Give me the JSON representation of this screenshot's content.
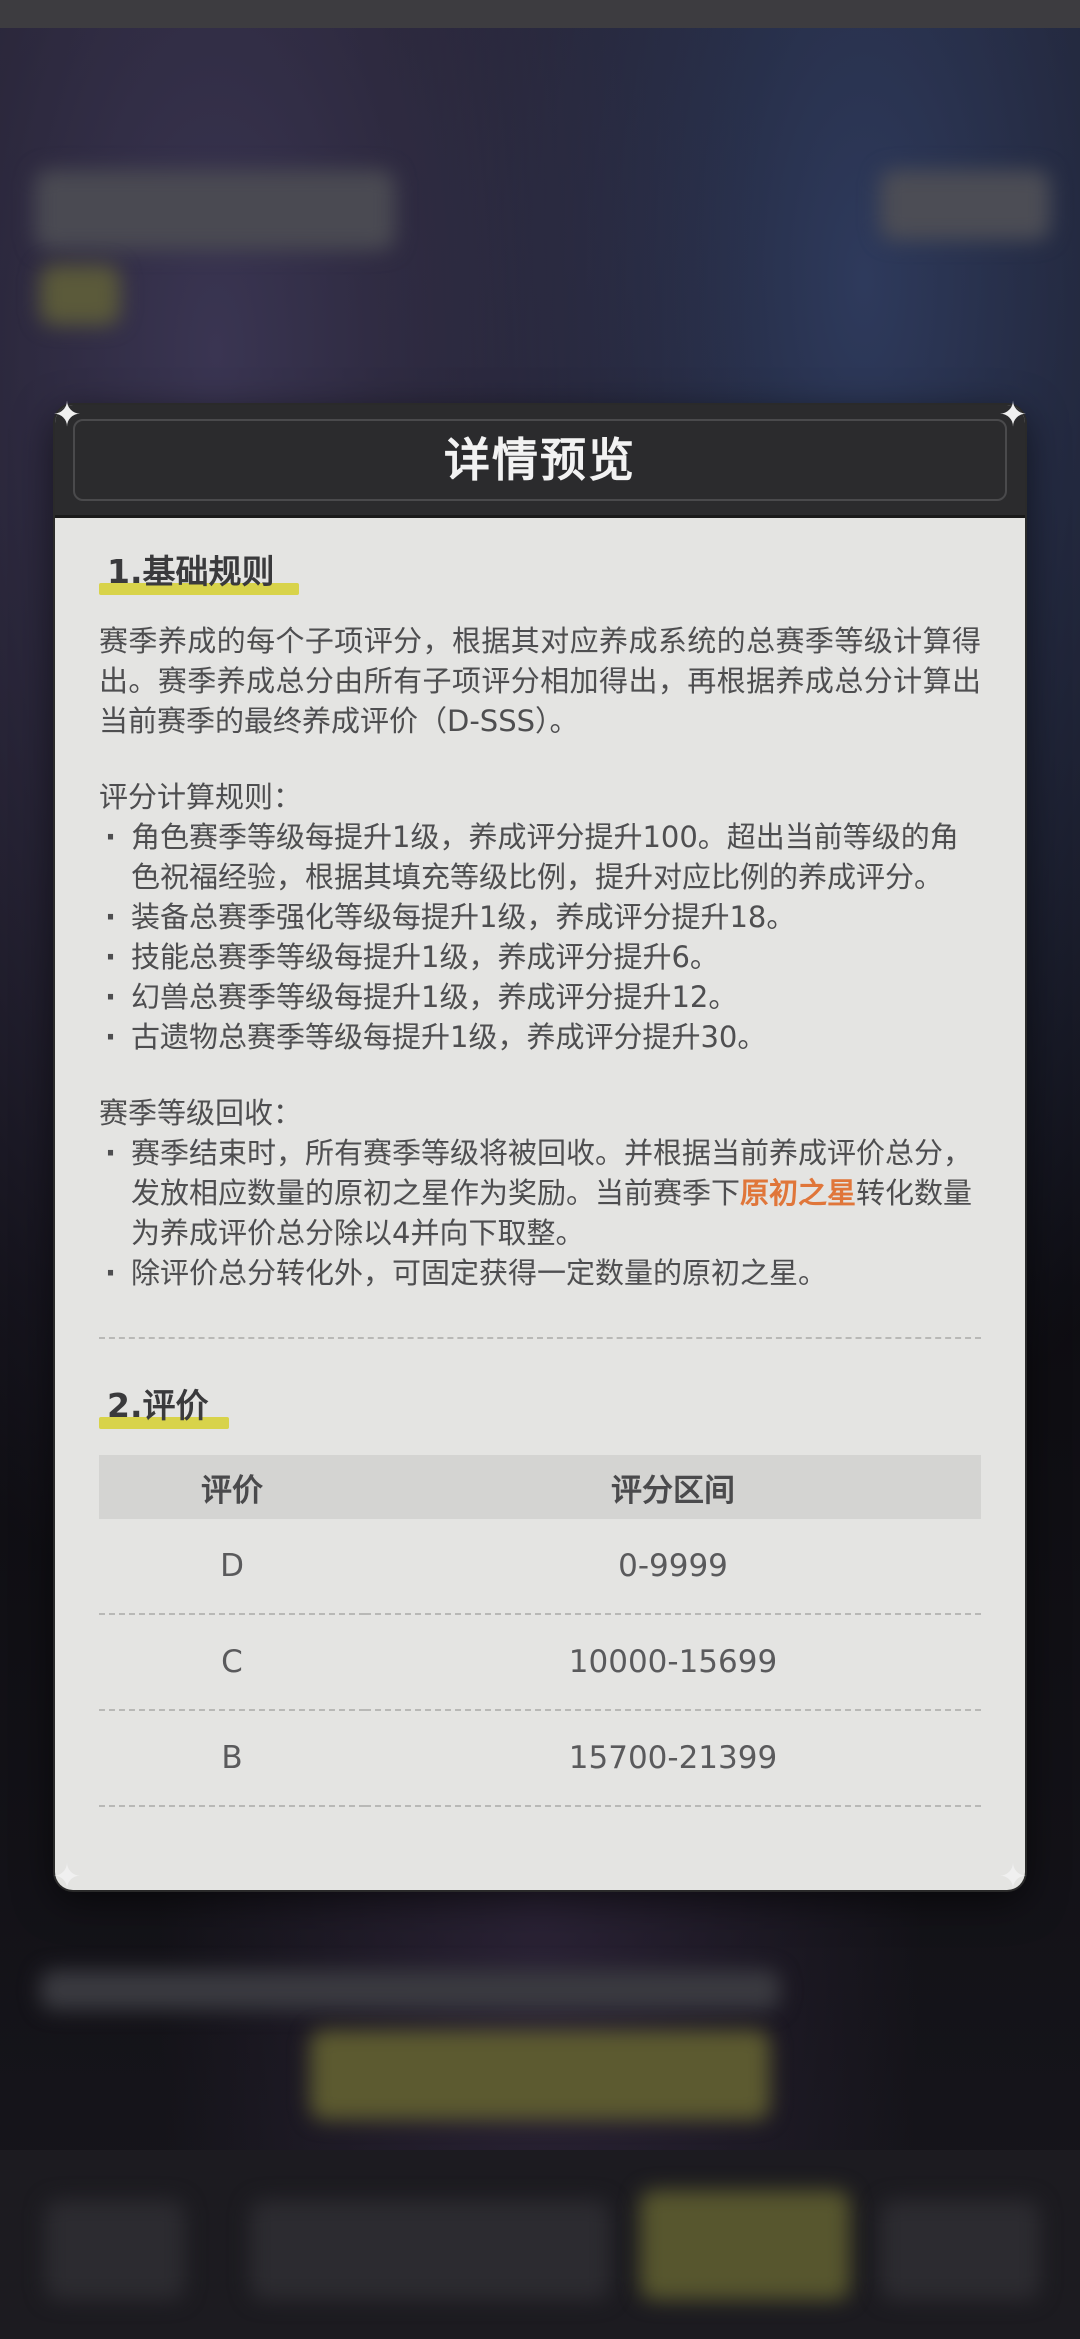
{
  "dialog": {
    "title": "详情预览",
    "sections": {
      "rules": {
        "heading": "1.基础规则",
        "intro": "赛季养成的每个子项评分，根据其对应养成系统的总赛季等级计算得出。赛季养成总分由所有子项评分相加得出，再根据养成总分计算出当前赛季的最终养成评价（D-SSS）。",
        "calc_title": "评分计算规则：",
        "calc_items": [
          "角色赛季等级每提升1级，养成评分提升100。超出当前等级的角色祝福经验，根据其填充等级比例，提升对应比例的养成评分。",
          "装备总赛季强化等级每提升1级，养成评分提升18。",
          "技能总赛季等级每提升1级，养成评分提升6。",
          "幻兽总赛季等级每提升1级，养成评分提升12。",
          "古遗物总赛季等级每提升1级，养成评分提升30。"
        ],
        "recycle_title": "赛季等级回收：",
        "recycle_item1_pre": "赛季结束时，所有赛季等级将被回收。并根据当前养成评价总分，发放相应数量的原初之星作为奖励。当前赛季下",
        "recycle_item1_highlight": "原初之星",
        "recycle_item1_post": "转化数量为养成评价总分除以4并向下取整。",
        "recycle_item2": "除评价总分转化外，可固定获得一定数量的原初之星。"
      },
      "grades": {
        "heading": "2.评价",
        "col_grade": "评价",
        "col_range": "评分区间",
        "rows": [
          {
            "grade": "D",
            "range": "0-9999"
          },
          {
            "grade": "C",
            "range": "10000-15699"
          },
          {
            "grade": "B",
            "range": "15700-21399"
          }
        ]
      }
    }
  },
  "colors": {
    "highlight_bar": "#d8d34a",
    "accent_orange": "#e0763a",
    "header_bg": "#2b2b2d",
    "panel_bg": "#e4e4e2"
  }
}
